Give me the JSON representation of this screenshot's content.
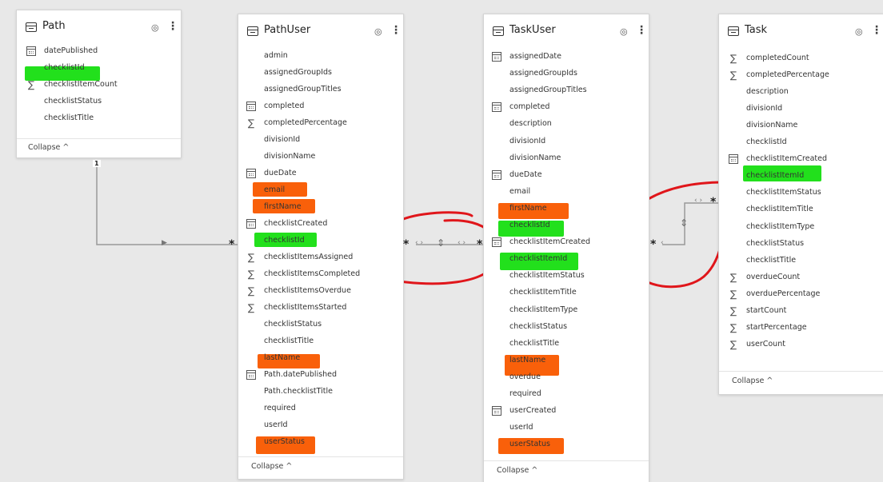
{
  "tables": {
    "path": {
      "title": "Path",
      "fields": [
        "datePublished",
        "checklistId",
        "checklistItemCount",
        "checklistStatus",
        "checklistTitle"
      ],
      "collapse": "Collapse ^"
    },
    "pathuser": {
      "title": "PathUser",
      "fields": [
        "admin",
        "assignedGroupIds",
        "assignedGroupTitles",
        "completed",
        "completedPercentage",
        "divisionId",
        "divisionName",
        "dueDate",
        "email",
        "firstName",
        "checklistCreated",
        "checklistId",
        "checklistItemsAssigned",
        "checklistItemsCompleted",
        "checklistItemsOverdue",
        "checklistItemsStarted",
        "checklistStatus",
        "checklistTitle",
        "lastName",
        "Path.datePublished",
        "Path.checklistTitle",
        "required",
        "userId",
        "userStatus"
      ],
      "collapse": "Collapse ^"
    },
    "taskuser": {
      "title": "TaskUser",
      "fields": [
        "assignedDate",
        "assignedGroupIds",
        "assignedGroupTitles",
        "completed",
        "description",
        "divisionId",
        "divisionName",
        "dueDate",
        "email",
        "firstName",
        "checklistId",
        "checklistItemCreated",
        "checklistItemId",
        "checklistItemStatus",
        "checklistItemTitle",
        "checklistItemType",
        "checklistStatus",
        "checklistTitle",
        "lastName",
        "overdue",
        "required",
        "userCreated",
        "userId",
        "userStatus"
      ],
      "collapse": "Collapse ^"
    },
    "task": {
      "title": "Task",
      "fields": [
        "completedCount",
        "completedPercentage",
        "description",
        "divisionId",
        "divisionName",
        "checklistId",
        "checklistItemCreated",
        "checklistItemId",
        "checklistItemStatus",
        "checklistItemTitle",
        "checklistItemType",
        "checklistStatus",
        "checklistTitle",
        "overdueCount",
        "overduePercentage",
        "startCount",
        "startPercentage",
        "userCount"
      ],
      "collapse": "Collapse ^"
    }
  },
  "relationships": {
    "one_label": "1",
    "many_label": "*"
  },
  "icons": {
    "table": "table-icon",
    "visibility": "eye-icon",
    "more": "more-options-icon",
    "date": "calendar-icon",
    "measure": "sigma-icon"
  },
  "colors": {
    "highlight_green": "#22e01c",
    "highlight_orange": "#f9600a",
    "annotation_red": "#e0161b"
  }
}
